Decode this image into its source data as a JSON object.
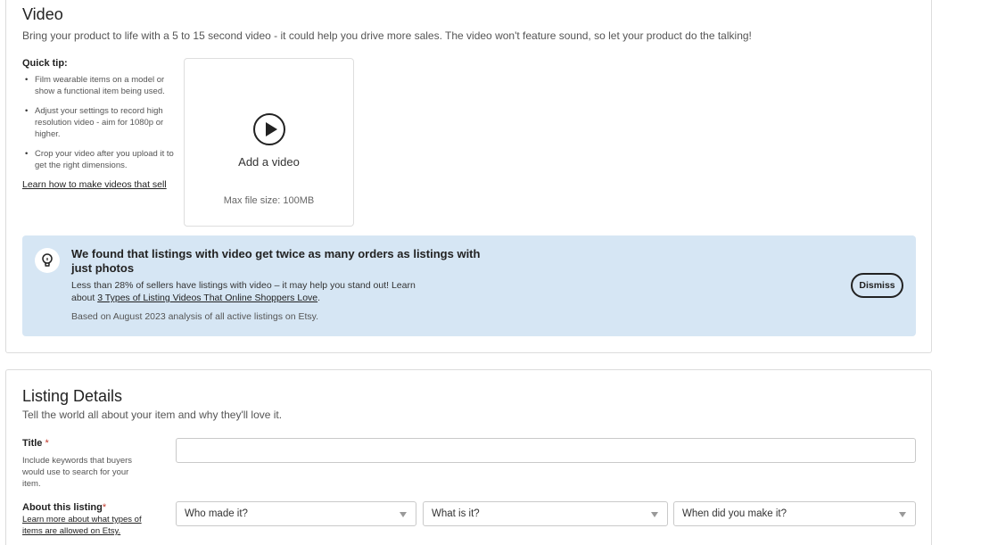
{
  "video": {
    "title": "Video",
    "description": "Bring your product to life with a 5 to 15 second video - it could help you drive more sales. The video won't feature sound, so let your product do the talking!",
    "quick_tip": {
      "heading": "Quick tip:",
      "items": [
        "Film wearable items on a model or show a functional item being used.",
        "Adjust your settings to record high resolution video - aim for 1080p or higher.",
        "Crop your video after you upload it to get the right dimensions."
      ],
      "link": "Learn how to make videos that sell"
    },
    "upload": {
      "label": "Add a video",
      "max_size": "Max file size: 100MB",
      "icon": "play-icon"
    },
    "banner": {
      "icon": "lightbulb-icon",
      "title": "We found that listings with video get twice as many orders as listings with just photos",
      "text_before": "Less than 28% of sellers have listings with video – it may help you stand out! Learn about ",
      "link": "3 Types of Listing Videos That Online Shoppers Love",
      "text_after": ".",
      "note": "Based on August 2023 analysis of all active listings on Etsy.",
      "dismiss": "Dismiss",
      "background": "#d6e6f4"
    }
  },
  "listing_details": {
    "title": "Listing Details",
    "description": "Tell the world all about your item and why they'll love it.",
    "title_field": {
      "label": "Title",
      "required_mark": "*",
      "help": "Include keywords that buyers would use to search for your item.",
      "value": ""
    },
    "about": {
      "label": "About this listing",
      "required_mark": "*",
      "help_link": "Learn more about what types of items are allowed on Etsy.",
      "selects": [
        {
          "value": "Who made it?"
        },
        {
          "value": "What is it?"
        },
        {
          "value": "When did you make it?"
        }
      ]
    }
  }
}
